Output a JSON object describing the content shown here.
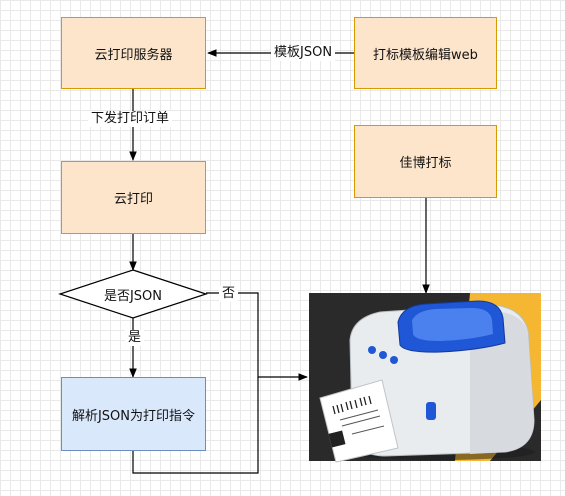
{
  "nodes": {
    "cloud_server": "云打印服务器",
    "template_editor": "打标模板编辑web",
    "cloud_print": "云打印",
    "jiabo": "佳博打标",
    "decision": "是否JSON",
    "parse": "解析JSON为打印指令"
  },
  "edge_labels": {
    "template_json": "模板JSON",
    "send_order": "下发打印订单",
    "no": "否",
    "yes": "是"
  },
  "colors": {
    "process_fill": "#fde5cc",
    "process_stroke": "#d79b00",
    "parse_fill": "#dae8fc",
    "parse_stroke": "#6c8ebf"
  },
  "icons": {
    "printer": "label-printer-photo"
  }
}
